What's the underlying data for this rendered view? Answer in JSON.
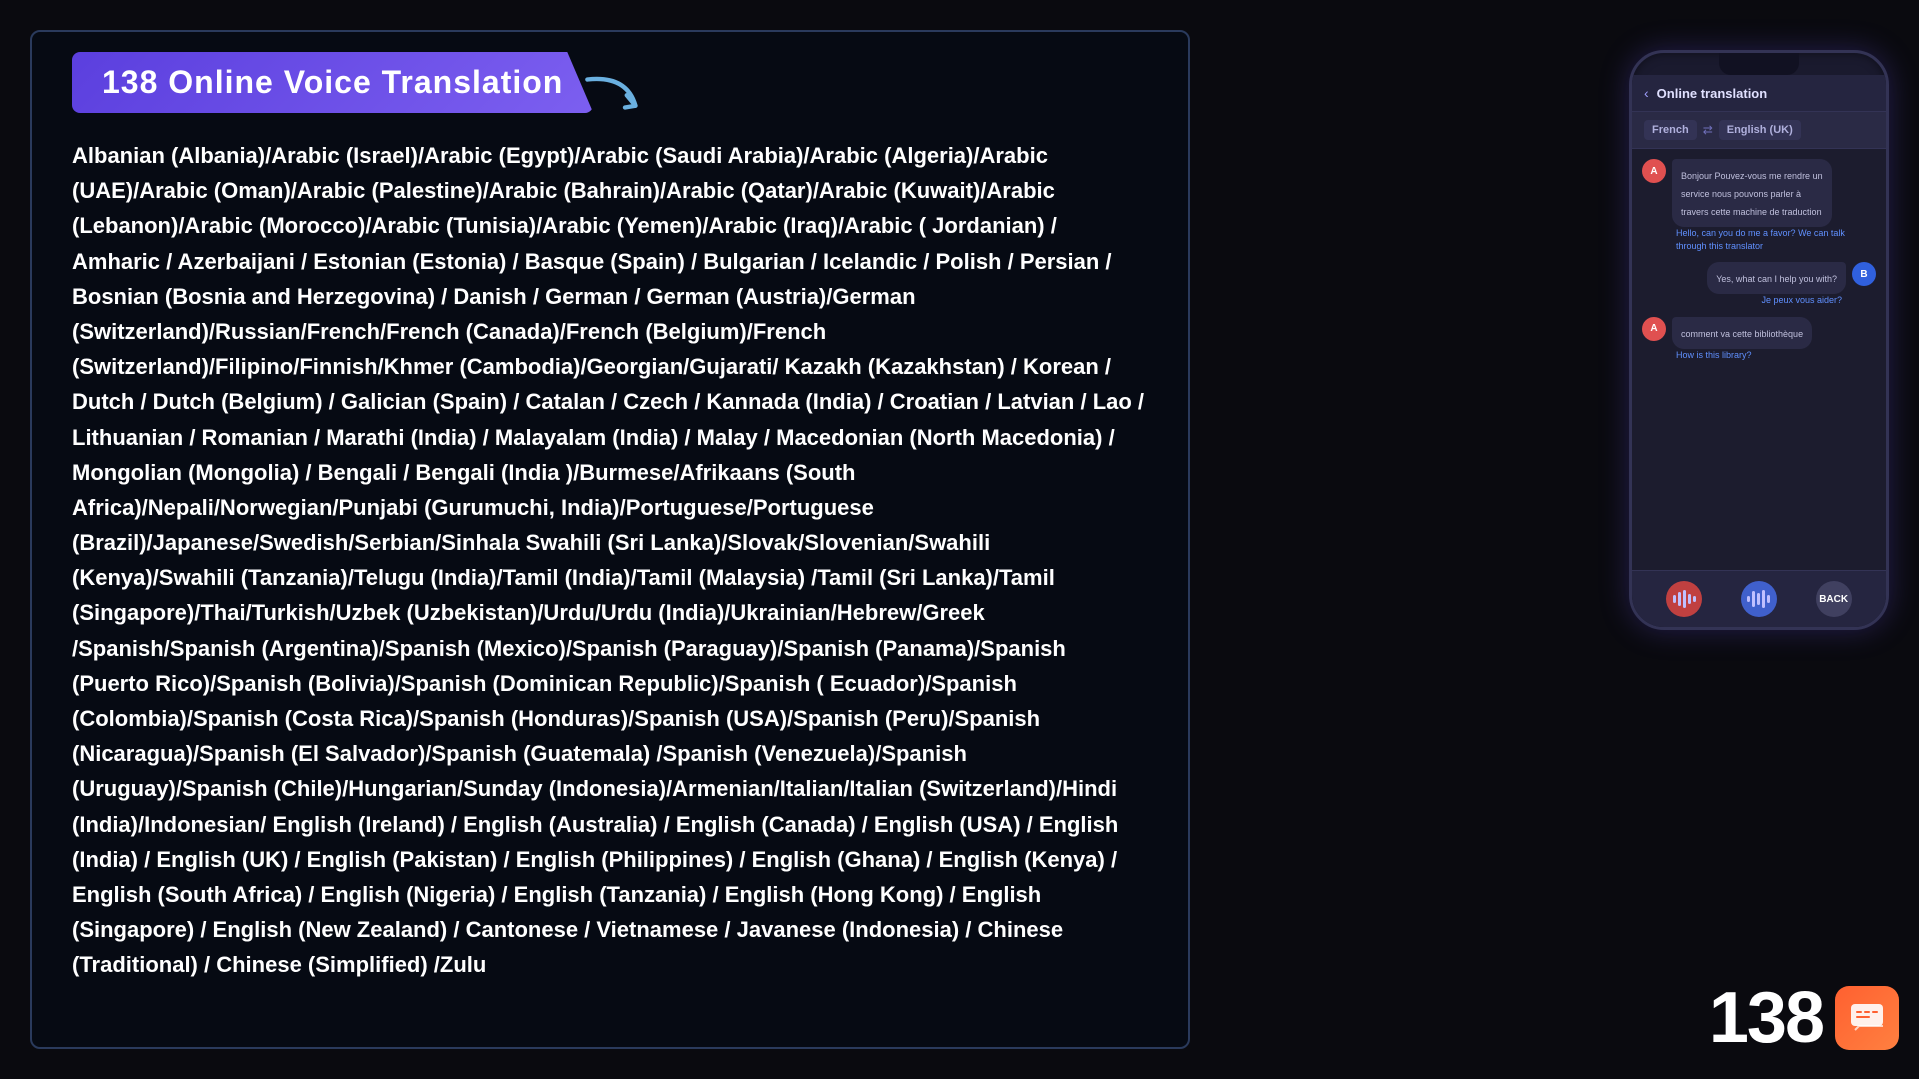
{
  "title": "138 Online Voice Translation",
  "languages_text": "Albanian (Albania)/Arabic (Israel)/Arabic (Egypt)/Arabic (Saudi Arabia)/Arabic (Algeria)/Arabic (UAE)/Arabic (Oman)/Arabic (Palestine)/Arabic (Bahrain)/Arabic (Qatar)/Arabic (Kuwait)/Arabic (Lebanon)/Arabic (Morocco)/Arabic (Tunisia)/Arabic (Yemen)/Arabic (Iraq)/Arabic ( Jordanian) / Amharic / Azerbaijani / Estonian (Estonia) / Basque (Spain) / Bulgarian / Icelandic / Polish / Persian / Bosnian (Bosnia and Herzegovina) / Danish / German / German (Austria)/German (Switzerland)/Russian/French/French (Canada)/French (Belgium)/French (Switzerland)/Filipino/Finnish/Khmer (Cambodia)/Georgian/Gujarati/ Kazakh (Kazakhstan) / Korean / Dutch / Dutch (Belgium) / Galician (Spain) / Catalan / Czech / Kannada (India) / Croatian / Latvian / Lao / Lithuanian / Romanian / Marathi (India) / Malayalam (India) / Malay / Macedonian (North Macedonia) / Mongolian (Mongolia) / Bengali / Bengali (India )/Burmese/Afrikaans (South Africa)/Nepali/Norwegian/Punjabi (Gurumuchi, India)/Portuguese/Portuguese (Brazil)/Japanese/Swedish/Serbian/Sinhala Swahili (Sri Lanka)/Slovak/Slovenian/Swahili (Kenya)/Swahili (Tanzania)/Telugu (India)/Tamil (India)/Tamil (Malaysia) /Tamil (Sri Lanka)/Tamil (Singapore)/Thai/Turkish/Uzbek (Uzbekistan)/Urdu/Urdu (India)/Ukrainian/Hebrew/Greek /Spanish/Spanish (Argentina)/Spanish (Mexico)/Spanish (Paraguay)/Spanish (Panama)/Spanish (Puerto Rico)/Spanish (Bolivia)/Spanish (Dominican Republic)/Spanish ( Ecuador)/Spanish (Colombia)/Spanish (Costa Rica)/Spanish (Honduras)/Spanish (USA)/Spanish (Peru)/Spanish (Nicaragua)/Spanish (El Salvador)/Spanish (Guatemala) /Spanish (Venezuela)/Spanish (Uruguay)/Spanish (Chile)/Hungarian/Sunday (Indonesia)/Armenian/Italian/Italian (Switzerland)/Hindi (India)/Indonesian/ English (Ireland) / English (Australia) / English (Canada) / English (USA) / English (India) / English (UK) / English (Pakistan) / English (Philippines) / English (Ghana) / English (Kenya) / English (South Africa) / English (Nigeria) / English (Tanzania) / English (Hong Kong) / English (Singapore) / English (New Zealand) / Cantonese / Vietnamese / Javanese (Indonesia) / Chinese (Traditional) / Chinese (Simplified) /Zulu",
  "phone": {
    "header": {
      "back_label": "‹",
      "title": "Online translation"
    },
    "lang_from": "French",
    "swap_icon": "⇄",
    "lang_to": "English (UK)",
    "messages": [
      {
        "side": "left",
        "avatar": "A",
        "text": "Bonjour Pouvez-vous me rendre un service nous pouvons parler à travers cette machine de traduction",
        "translation": "Hello, can you do me a favor? We can talk through this translator"
      },
      {
        "side": "right",
        "avatar": "B",
        "text": "Yes, what can I help you with?",
        "translation": "Je peux vous aider?"
      },
      {
        "side": "left",
        "avatar": "A",
        "text": "comment va cette bibliothèque",
        "translation": "How is this library?"
      }
    ],
    "bottom_buttons": {
      "left": "🎤",
      "middle": "🎵",
      "right": "BACK"
    }
  },
  "branding": {
    "number": "138"
  }
}
